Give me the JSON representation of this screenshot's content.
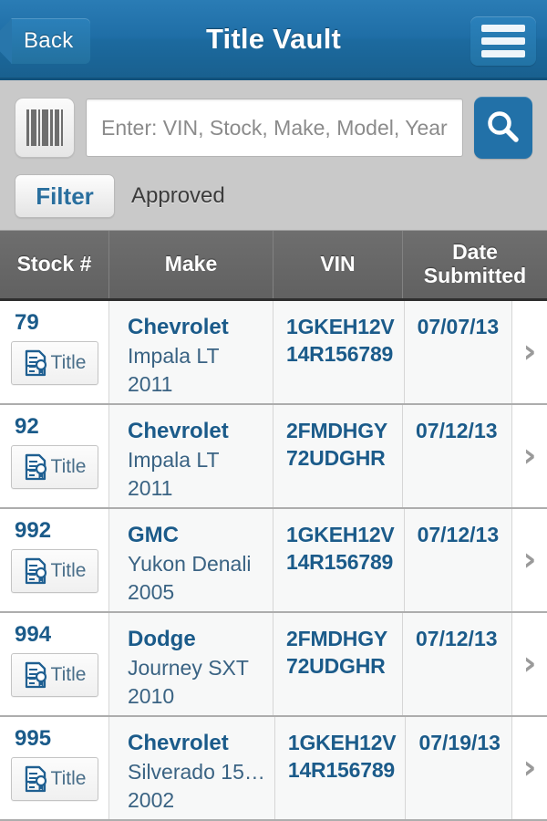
{
  "header": {
    "back_label": "Back",
    "title": "Title Vault",
    "menu_icon": "hamburger-menu-icon"
  },
  "search": {
    "barcode_icon": "barcode-scan-icon",
    "placeholder": "Enter: VIN, Stock, Make, Model, Year",
    "value": "",
    "search_icon": "search-icon"
  },
  "filter": {
    "button_label": "Filter",
    "status_label": "Approved"
  },
  "table": {
    "columns": [
      {
        "label": "Stock #"
      },
      {
        "label": "Make"
      },
      {
        "label": "VIN"
      },
      {
        "label": "Date\nSubmitted",
        "line1": "Date",
        "line2": "Submitted"
      }
    ],
    "title_button_label": "Title",
    "title_button_icon": "document-seal-icon",
    "row_arrow_icon": "chevron-right-icon",
    "rows": [
      {
        "stock": "79",
        "title_label": "Title",
        "make": "Chevrolet",
        "model": "Impala LT",
        "year": "2011",
        "vin_line1": "1GKEH12V",
        "vin_line2": "14R156789",
        "date": "07/07/13"
      },
      {
        "stock": "92",
        "title_label": "Title",
        "make": "Chevrolet",
        "model": "Impala LT",
        "year": "2011",
        "vin_line1": "2FMDHGY",
        "vin_line2": "72UDGHR",
        "date": "07/12/13"
      },
      {
        "stock": "992",
        "title_label": "Title",
        "make": "GMC",
        "model": "Yukon Denali",
        "year": "2005",
        "vin_line1": "1GKEH12V",
        "vin_line2": "14R156789",
        "date": "07/12/13"
      },
      {
        "stock": "994",
        "title_label": "Title",
        "make": "Dodge",
        "model": "Journey SXT",
        "year": "2010",
        "vin_line1": "2FMDHGY",
        "vin_line2": "72UDGHR",
        "date": "07/12/13"
      },
      {
        "stock": "995",
        "title_label": "Title",
        "make": "Chevrolet",
        "model": "Silverado 15…",
        "year": "2002",
        "vin_line1": "1GKEH12V",
        "vin_line2": "14R156789",
        "date": "07/19/13"
      }
    ]
  },
  "colors": {
    "header_blue": "#1f6ea6",
    "accent_blue": "#2271a8",
    "link_blue": "#1b5b8a",
    "toolbar_gray": "#c9c9c9",
    "table_header_gray": "#6e6e6e"
  }
}
